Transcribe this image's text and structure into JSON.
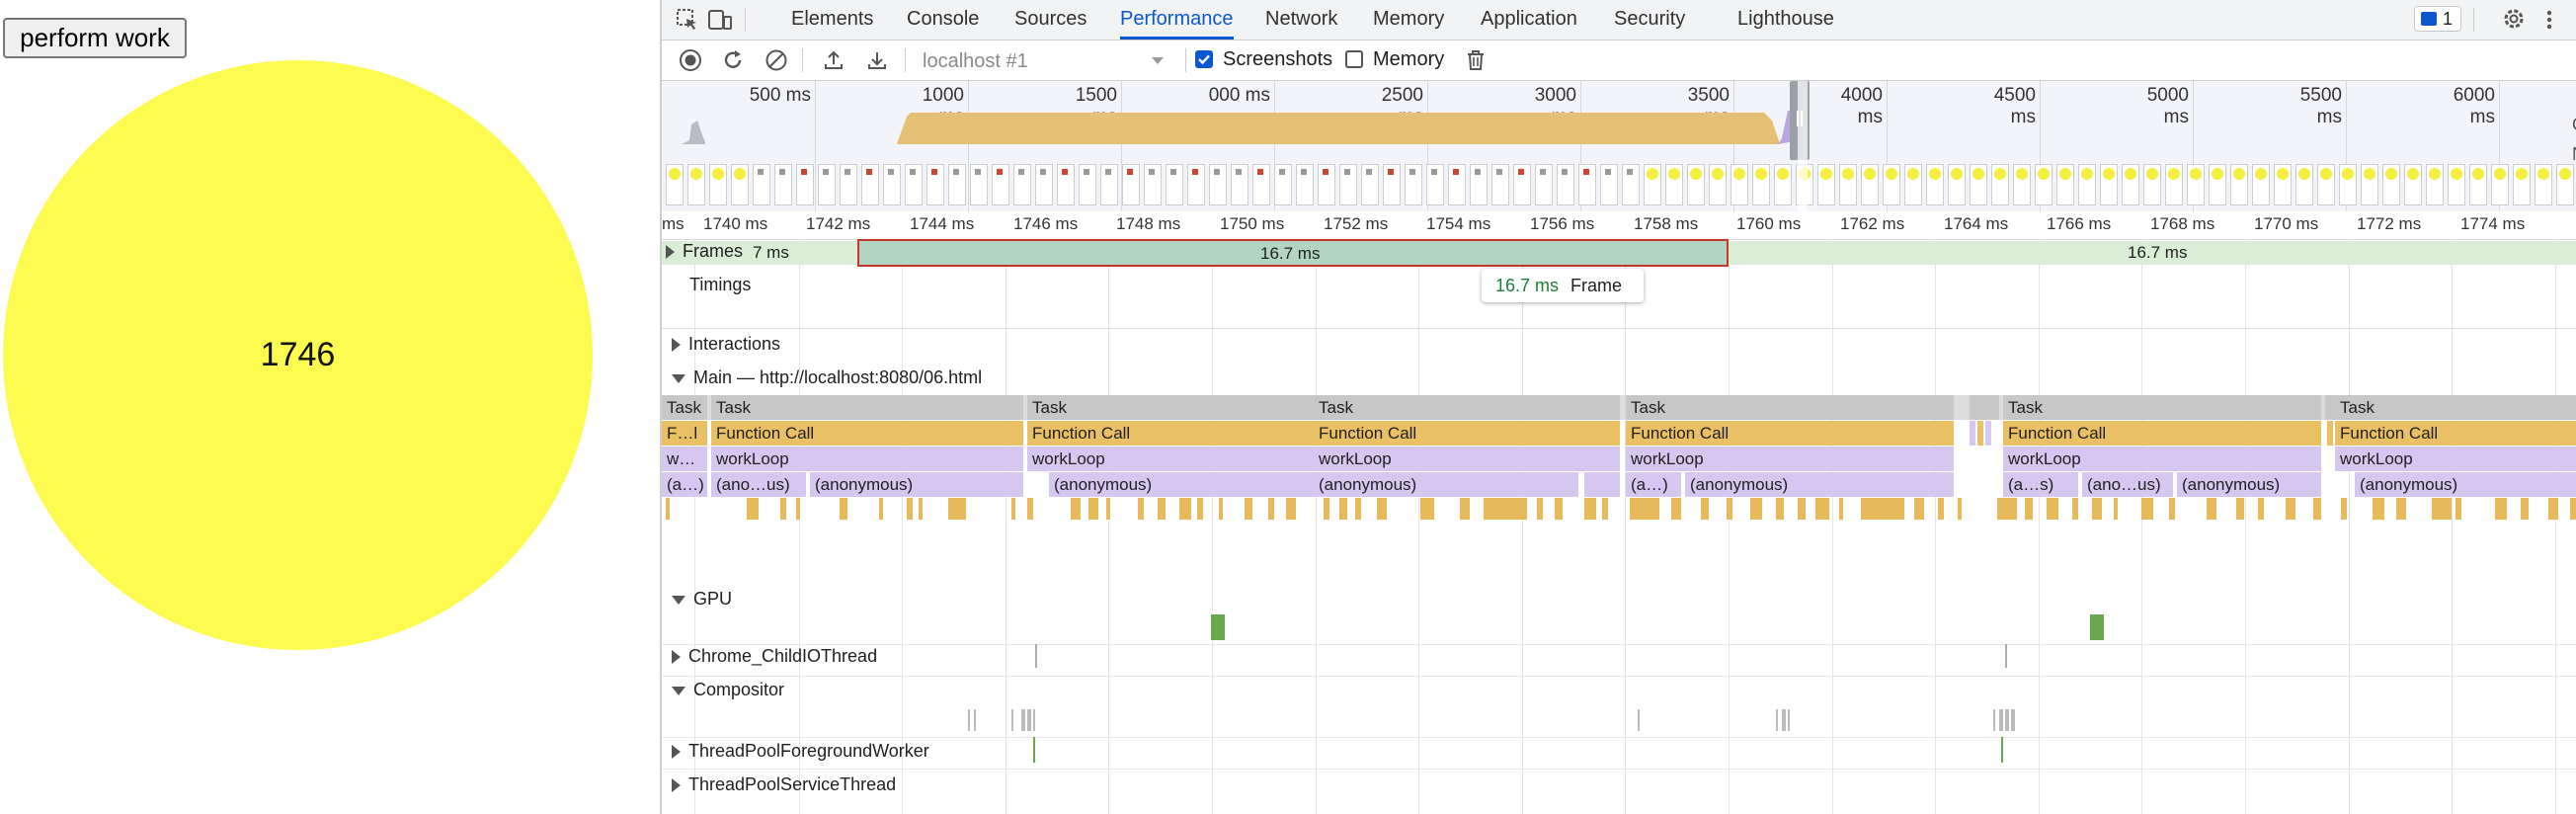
{
  "page": {
    "button_label": "perform work",
    "counter": "1746",
    "circle_color": "#fdfb50"
  },
  "devtools": {
    "tabs": [
      "Elements",
      "Console",
      "Sources",
      "Performance",
      "Network",
      "Memory",
      "Application",
      "Security",
      "Lighthouse"
    ],
    "active_tab": "Performance",
    "issues_count": "1",
    "toolbar": {
      "target": "localhost #1",
      "screenshots_label": "Screenshots",
      "screenshots_checked": true,
      "memory_label": "Memory",
      "memory_checked": false
    },
    "overview_ticks": [
      "500 ms",
      "1000 ms",
      "1500 ms",
      "000 ms",
      "2500 ms",
      "3000 ms",
      "3500 ms",
      "4000 ms",
      "4500 ms",
      "5000 ms",
      "5500 ms",
      "6000 ms"
    ],
    "overview_edge_labels": [
      "C",
      "N"
    ],
    "ruler_ticks": [
      "ms",
      "1740 ms",
      "1742 ms",
      "1744 ms",
      "1746 ms",
      "1748 ms",
      "1750 ms",
      "1752 ms",
      "1754 ms",
      "1756 ms",
      "1758 ms",
      "1760 ms",
      "1762 ms",
      "1764 ms",
      "1766 ms",
      "1768 ms",
      "1770 ms",
      "1772 ms",
      "1774 ms"
    ],
    "tracks": {
      "frames": "Frames",
      "timings": "Timings",
      "interactions": "Interactions",
      "main": "Main — http://localhost:8080/06.html",
      "gpu": "GPU",
      "child_io": "Chrome_ChildIOThread",
      "compositor": "Compositor",
      "pool_fg": "ThreadPoolForegroundWorker",
      "pool_svc": "ThreadPoolServiceThread"
    },
    "frames": {
      "left_label": "7 ms",
      "selected_label": "16.7 ms",
      "right_label": "16.7 ms"
    },
    "tooltip": {
      "duration": "16.7 ms",
      "label": "Frame"
    },
    "task_label": "Task",
    "function_call_label": "Function Call",
    "function_call_short": "F…l",
    "workloop_label": "workLoop",
    "workloop_short": "w…",
    "anonymous_label": "(anonymous)",
    "anon_short1": "(a…)",
    "anon_short2": "(ano…us)",
    "anon_short3": "(a…s)",
    "colors": {
      "task": "#c7c7c7",
      "function_call": "#e9c064",
      "workloop": "#d5c7ef",
      "frame_fill": "#d9eed4",
      "frame_selected": "#b2d4c0",
      "selection_border": "#c5392b",
      "accent": "#0b57d0"
    }
  }
}
